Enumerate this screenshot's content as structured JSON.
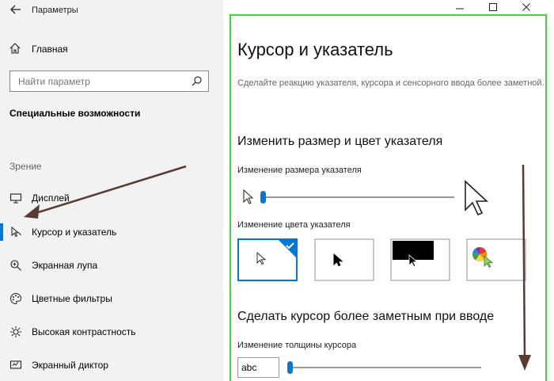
{
  "window": {
    "title": "Параметры"
  },
  "sidebar": {
    "home_label": "Главная",
    "search_placeholder": "Найти параметр",
    "section_title": "Специальные возможности",
    "group_label": "Зрение",
    "items": [
      {
        "label": "Дисплей",
        "icon": "monitor-icon"
      },
      {
        "label": "Курсор и указатель",
        "icon": "cursor-icon"
      },
      {
        "label": "Экранная лупа",
        "icon": "magnifier-icon"
      },
      {
        "label": "Цветные фильтры",
        "icon": "palette-icon"
      },
      {
        "label": "Высокая контрастность",
        "icon": "contrast-icon"
      },
      {
        "label": "Экранный диктор",
        "icon": "narrator-icon"
      }
    ]
  },
  "main": {
    "title": "Курсор и указатель",
    "description": "Сделайте реакцию указателя, курсора и сенсорного ввода более заметной.",
    "size_color_heading": "Изменить размер и цвет указателя",
    "size_label": "Изменение размера указателя",
    "size_value": 0.0,
    "color_label": "Изменение цвета указателя",
    "color_options": [
      {
        "name": "white",
        "selected": true
      },
      {
        "name": "black",
        "selected": false
      },
      {
        "name": "inverted",
        "selected": false
      },
      {
        "name": "custom",
        "selected": false
      }
    ],
    "cursor_heading": "Сделать курсор более заметным при вводе",
    "thickness_label": "Изменение толщины курсора",
    "thickness_preview": "abc",
    "thickness_value": 0.0
  },
  "colors": {
    "accent": "#0078d7",
    "highlight_border": "#3dd63d",
    "annotation_arrow": "#5a3a32"
  }
}
